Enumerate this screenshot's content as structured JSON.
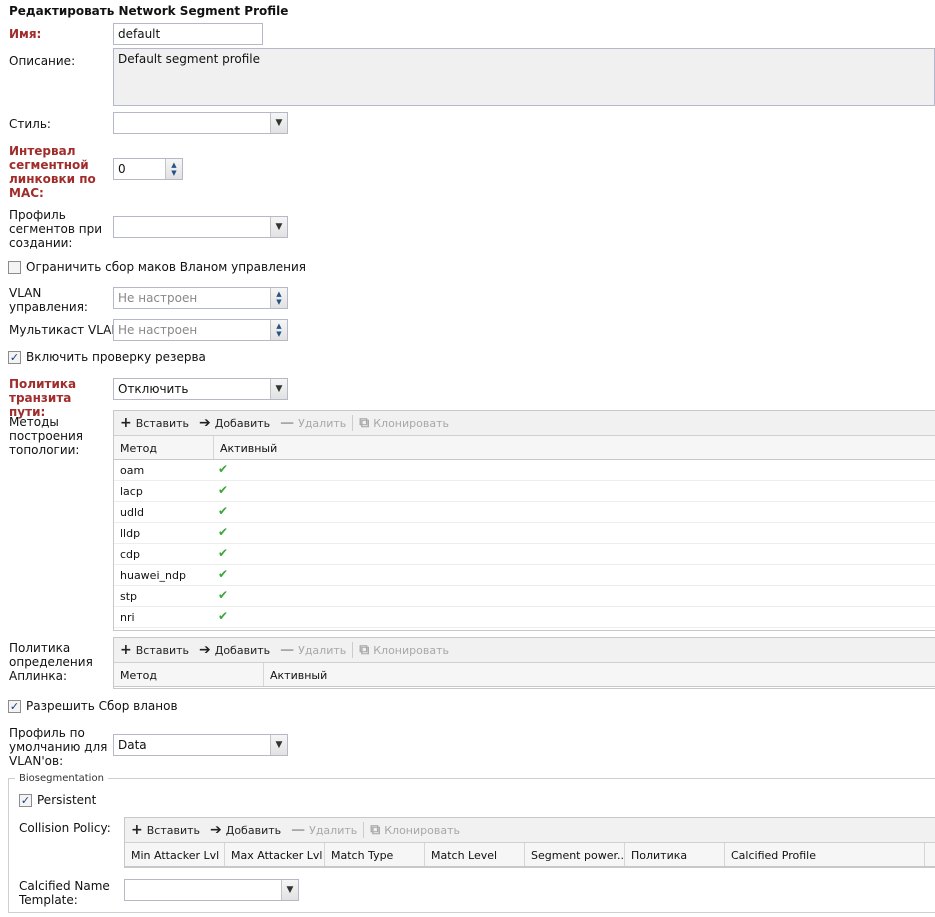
{
  "title": "Редактировать Network Segment Profile",
  "name": {
    "label": "Имя:",
    "value": "default"
  },
  "description": {
    "label": "Описание:",
    "value": "Default segment profile"
  },
  "style": {
    "label": "Стиль:",
    "value": ""
  },
  "mac_interval": {
    "label": "Интервал сегментной линковки по MAC:",
    "value": "0"
  },
  "segment_profile": {
    "label": "Профиль сегментов при создании:",
    "value": ""
  },
  "limit_macs": {
    "label": "Ограничить сбор маков Вланом управления",
    "checked": false
  },
  "mgmt_vlan": {
    "label": "VLAN управления:",
    "placeholder": "Не настроен"
  },
  "mcast_vlan": {
    "label": "Мультикаст VLAN:",
    "placeholder": "Не настроен"
  },
  "reserve_check": {
    "label": "Включить проверку резерва",
    "checked": true
  },
  "transit_policy": {
    "label": "Политика транзита пути:",
    "value": "Отключить"
  },
  "toolbar": {
    "insert": "Вставить",
    "add": "Добавить",
    "delete": "Удалить",
    "clone": "Клонировать"
  },
  "topology": {
    "label": "Методы построения топологии:",
    "columns": [
      "Метод",
      "Активный"
    ],
    "rows": [
      {
        "method": "oam",
        "active": true
      },
      {
        "method": "lacp",
        "active": true
      },
      {
        "method": "udld",
        "active": true
      },
      {
        "method": "lldp",
        "active": true
      },
      {
        "method": "cdp",
        "active": true
      },
      {
        "method": "huawei_ndp",
        "active": true
      },
      {
        "method": "stp",
        "active": true
      },
      {
        "method": "nri",
        "active": true
      }
    ]
  },
  "uplink": {
    "label": "Политика определения Аплинка:",
    "columns": [
      "Метод",
      "Активный"
    ]
  },
  "allow_vlans": {
    "label": "Разрешить Сбор вланов",
    "checked": true
  },
  "vlan_profile": {
    "label": "Профиль по умолчанию для VLAN'ов:",
    "value": "Data"
  },
  "biosegmentation": {
    "legend": "Biosegmentation",
    "persistent": {
      "label": "Persistent",
      "checked": true
    },
    "collision_label": "Collision Policy:",
    "columns": [
      "Min Attacker Lvl",
      "Max Attacker Lvl",
      "Match Type",
      "Match Level",
      "Segment power...",
      "Политика",
      "Calcified Profile"
    ],
    "calcified_label": "Calcified Name Template:",
    "calcified_value": ""
  },
  "icons": {
    "insert": "plus-icon",
    "add": "add-arrow-icon",
    "delete": "minus-icon",
    "clone": "copy-icon",
    "checkmark": "check-icon",
    "dropdown": "chevron-down-icon",
    "spinner": "spinner-arrows-icon"
  },
  "colors": {
    "required_label": "#a02c2c",
    "check": "#3aa63a",
    "checkbox_tick": "#1a3f7a"
  }
}
